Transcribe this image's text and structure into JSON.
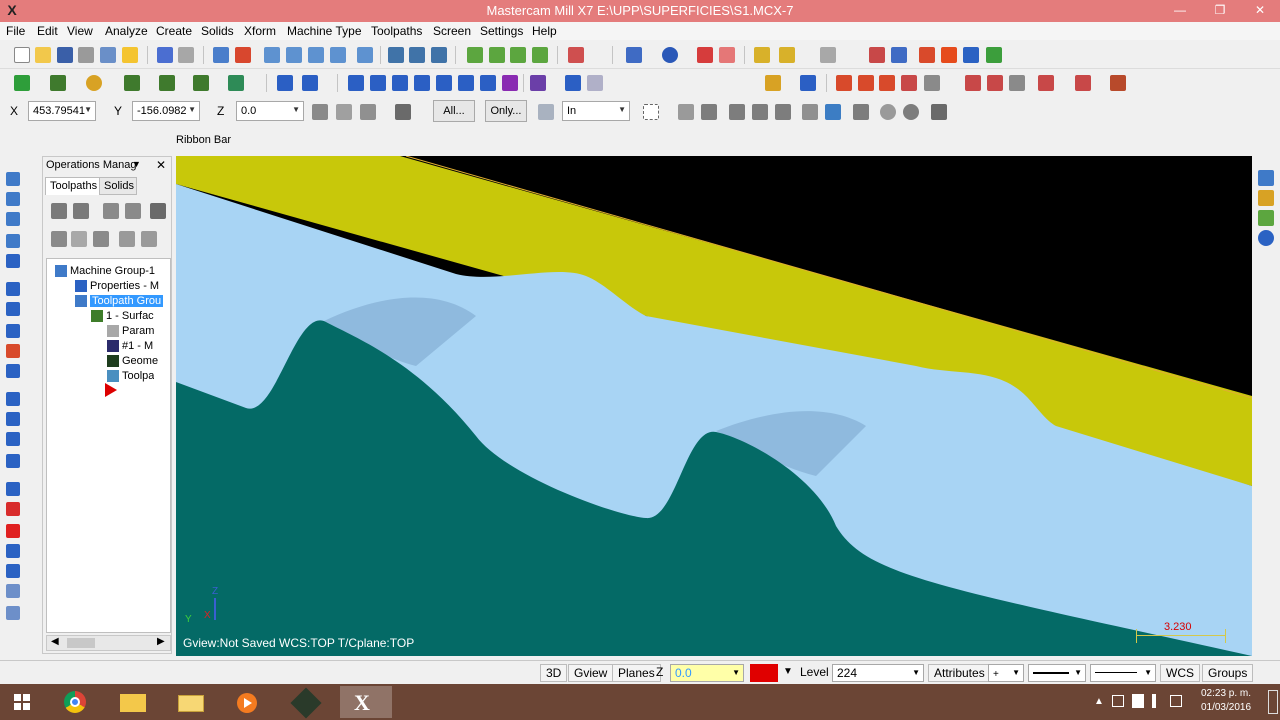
{
  "window": {
    "title": "Mastercam Mill X7  E:\\UPP\\SUPERFICIES\\S1.MCX-7",
    "app_icon": "mastercam-x-icon",
    "controls": [
      "minimize",
      "restore",
      "close"
    ]
  },
  "menu": [
    "File",
    "Edit",
    "View",
    "Analyze",
    "Create",
    "Solids",
    "Xform",
    "Machine Type",
    "Toolpaths",
    "Screen",
    "Settings",
    "Help"
  ],
  "ribbon": {
    "x_label": "X",
    "x_value": "453.79541",
    "y_label": "Y",
    "y_value": "-156.0982",
    "z_label": "Z",
    "z_value": "0.0",
    "all_button": "All...",
    "only_button": "Only...",
    "mode_value": "In",
    "bar_title": "Ribbon Bar"
  },
  "ops_manager": {
    "title": "Operations Manag",
    "tabs": [
      "Toolpaths",
      "Solids"
    ],
    "tree": [
      {
        "label": "Machine Group-1",
        "icon": "machine-group-icon"
      },
      {
        "label": "Properties - M",
        "icon": "properties-icon"
      },
      {
        "label": "Toolpath Grou",
        "icon": "toolpath-group-icon",
        "selected": true
      },
      {
        "label": "1 - Surfac",
        "icon": "operation-folder-icon"
      },
      {
        "label": "Param",
        "icon": "parameters-icon"
      },
      {
        "label": "#1 - M",
        "icon": "tool-icon"
      },
      {
        "label": "Geome",
        "icon": "geometry-icon"
      },
      {
        "label": "Toolpa",
        "icon": "toolpath-icon"
      }
    ],
    "insert_arrow_icon": "insert-arrow-icon"
  },
  "viewport": {
    "status": "Gview:Not Saved    WCS:TOP    T/Cplane:TOP",
    "scale_value": "3.230",
    "axis_labels": {
      "x": "X",
      "y": "Y",
      "z": "Z"
    },
    "colors": {
      "background": "#000000",
      "stock_top": "#c8c80a",
      "surface": "#a8d4f4",
      "base": "#046a66"
    }
  },
  "statusbar": {
    "mode_3d": "3D",
    "gview": "Gview",
    "planes": "Planes",
    "z_label": "Z",
    "z_value": "0.0",
    "color_value": "12",
    "level_label": "Level",
    "level_value": "224",
    "attributes": "Attributes",
    "wcs": "WCS",
    "groups": "Groups"
  },
  "taskbar": {
    "apps": [
      "windows-start-icon",
      "chrome-icon",
      "file-explorer-icon",
      "folder-icon",
      "media-player-icon",
      "game-icon",
      "mastercam-icon"
    ],
    "time": "02:23 p. m.",
    "date": "01/03/2016"
  }
}
